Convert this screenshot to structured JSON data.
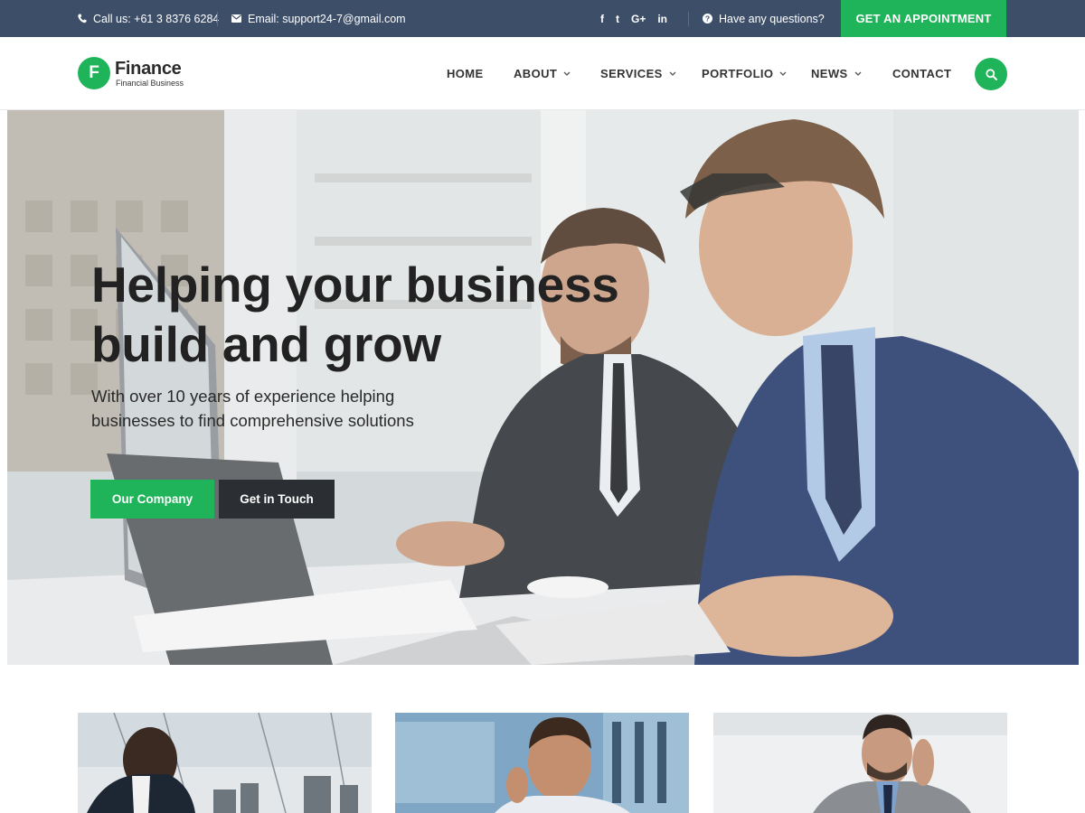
{
  "topbar": {
    "phone": "Call us: +61 3 8376 6284",
    "email": "Email: support24-7@gmail.com",
    "social": [
      "f",
      "t",
      "G+",
      "in"
    ],
    "questions": "Have any questions?",
    "appointment_label": "GET AN APPOINTMENT"
  },
  "header": {
    "logo_letter": "F",
    "logo_name": "Finance",
    "logo_tagline": "Financial Business",
    "nav": [
      {
        "label": "HOME"
      },
      {
        "label": "ABOUT"
      },
      {
        "label": "SERVICES"
      },
      {
        "label": "PORTFOLIO"
      },
      {
        "label": "NEWS"
      },
      {
        "label": "CONTACT"
      }
    ]
  },
  "hero": {
    "title_line1": "Helping your business",
    "title_line2": "build and grow",
    "subtitle_line1": "With over 10 years of experience helping",
    "subtitle_line2": "businesses to find comprehensive solutions",
    "primary_button": "Our Company",
    "secondary_button": "Get in Touch"
  },
  "colors": {
    "accent": "#1fb459",
    "topbar": "#3d4f68",
    "dark_button": "#2b2e33"
  },
  "icons": [
    "phone-icon",
    "envelope-icon",
    "question-icon",
    "search-icon",
    "chevron-down-icon"
  ]
}
